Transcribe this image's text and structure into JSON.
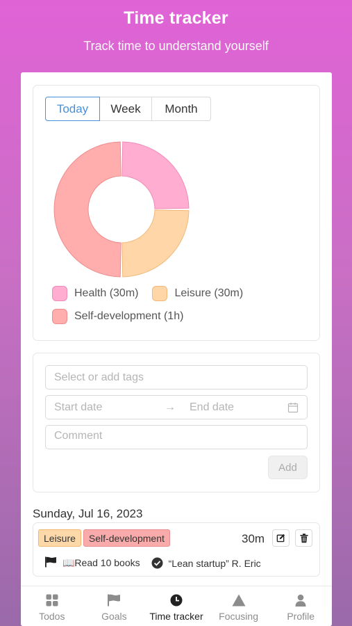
{
  "header": {
    "title": "Time tracker",
    "subtitle": "Track time to understand yourself"
  },
  "period_tabs": [
    {
      "label": "Today",
      "active": true
    },
    {
      "label": "Week",
      "active": false
    },
    {
      "label": "Month",
      "active": false
    }
  ],
  "chart_data": {
    "type": "pie",
    "categories": [
      "Health",
      "Leisure",
      "Self-development"
    ],
    "values": [
      30,
      30,
      60
    ],
    "unit": "minutes",
    "colors": [
      {
        "fill": "#ffadd0",
        "stroke": "#f08ab8"
      },
      {
        "fill": "#ffd6a8",
        "stroke": "#f0b879"
      },
      {
        "fill": "#ffadad",
        "stroke": "#ee8c8c"
      }
    ],
    "legend": [
      "Health (30m)",
      "Leisure (30m)",
      "Self-development (1h)"
    ],
    "legend_position": "bottom"
  },
  "form": {
    "tags_placeholder": "Select or add tags",
    "start_placeholder": "Start date",
    "end_placeholder": "End date",
    "comment_placeholder": "Comment",
    "add_label": "Add"
  },
  "entries_date": "Sunday, Jul 16, 2023",
  "entry": {
    "tags": [
      "Leisure",
      "Self-development"
    ],
    "duration": "30m",
    "goal": "📖Read 10 books",
    "comment": "“Lean startup” R. Eric"
  },
  "nav": [
    {
      "label": "Todos",
      "icon": "grid-icon",
      "active": false
    },
    {
      "label": "Goals",
      "icon": "flag-icon",
      "active": false
    },
    {
      "label": "Time tracker",
      "icon": "clock-icon",
      "active": true
    },
    {
      "label": "Focusing",
      "icon": "triangle-icon",
      "active": false
    },
    {
      "label": "Profile",
      "icon": "user-icon",
      "active": false
    }
  ]
}
